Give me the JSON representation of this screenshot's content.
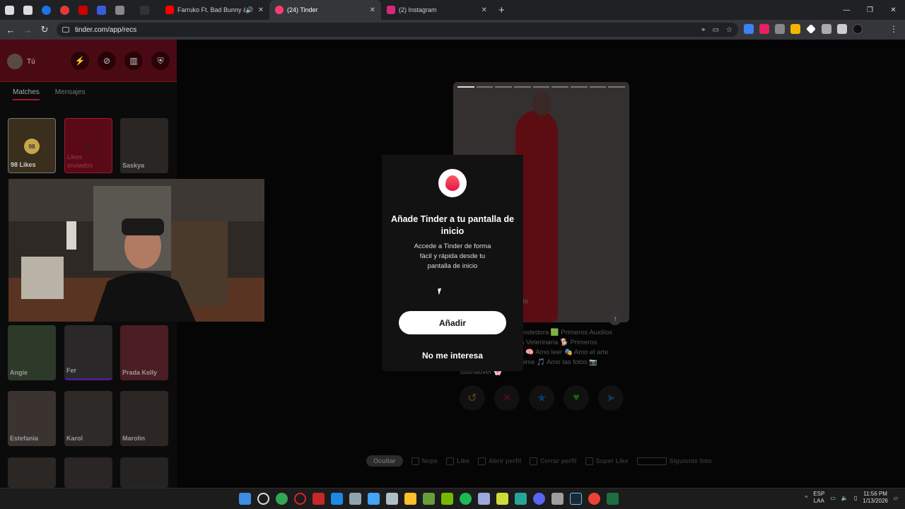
{
  "browser": {
    "tabs": [
      {
        "title": "Farruko Ft. Bad Bunny & La",
        "favicon_color": "#ff0000"
      },
      {
        "title": "(24) Tinder",
        "favicon_color": "#fe3c72"
      },
      {
        "title": "(2) Instagram",
        "favicon_color": "#d62976"
      }
    ],
    "pinned_colors": [
      "#dddddd",
      "#dddddd",
      "#1a73e8",
      "#e53935",
      "#cc0000",
      "#3b5bdb",
      "#888888",
      "#333333"
    ],
    "url": "tinder.com/app/recs",
    "extension_colors": [
      "#3b82f6",
      "#e91e63",
      "#888888",
      "#f4b400",
      "#ffffff",
      "#aaaaaa",
      "#cccccc",
      "#111111"
    ]
  },
  "sidebar": {
    "me_label": "Tú",
    "tabs": [
      "Matches",
      "Mensajes"
    ],
    "likes_count": "98",
    "likes_label": "98 Likes",
    "sent_label": "Likes enviados",
    "matches": [
      "Saskya",
      "Angie",
      "Fer",
      "Prada Kelly",
      "Estefania",
      "Karol",
      "Marolin"
    ]
  },
  "profile": {
    "bio_lines": [
      "nte",
      "endedora 🟩 Primeros Auxilios",
      "a Veterinaria 🐕 Primeros",
      "s 🧠 Amo leer 🎭 Amo el arte",
      "nime 🎵 Amo las fotos 📷",
      "Susnaover 🌸"
    ]
  },
  "modal": {
    "title": "Añade Tinder a tu pantalla de inicio",
    "body": "Accede a Tinder de forma fácil y rápida desde tu pantalla de inicio",
    "add_button": "Añadir",
    "decline_button": "No me interesa"
  },
  "hints": {
    "hide": "Ocultar",
    "nope": "Nope",
    "like": "Like",
    "open": "Abrir perfil",
    "close": "Cerrar perfil",
    "super": "Super Like",
    "next": "Siguiente foto"
  },
  "taskbar": {
    "lang1": "ESP",
    "lang2": "LAA",
    "time": "11:56 PM",
    "date": "1/13/2026"
  }
}
